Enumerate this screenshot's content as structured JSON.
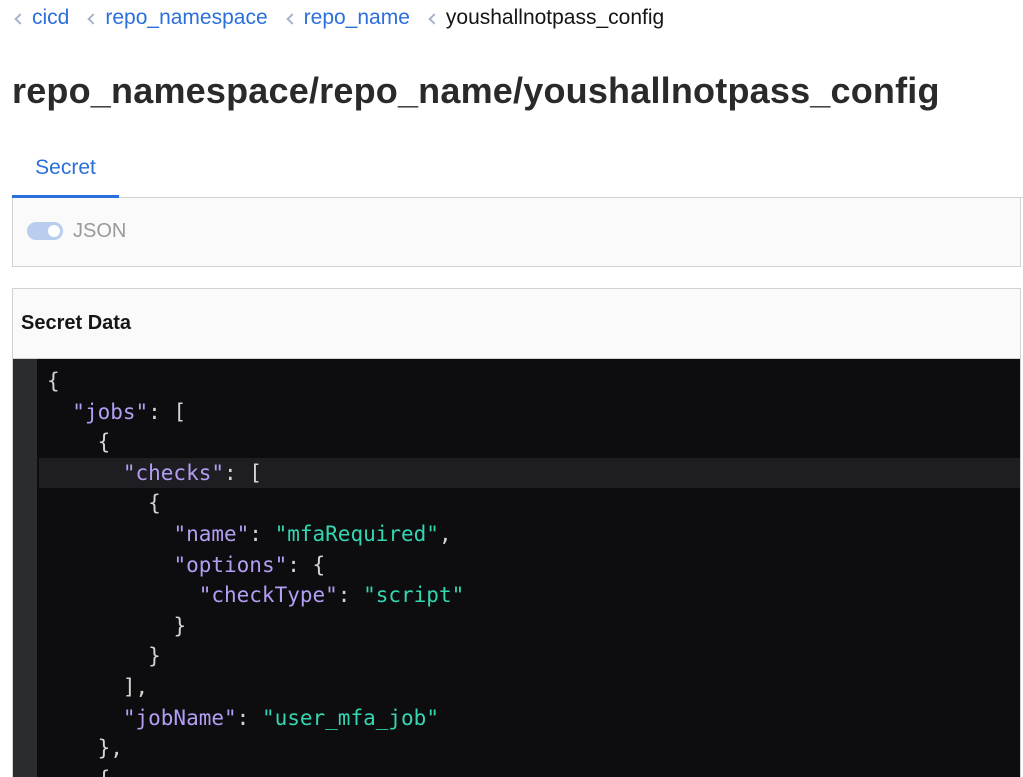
{
  "breadcrumb": [
    {
      "label": "cicd",
      "link": true
    },
    {
      "label": "repo_namespace",
      "link": true
    },
    {
      "label": "repo_name",
      "link": true
    },
    {
      "label": "youshallnotpass_config",
      "link": false
    }
  ],
  "page_title": "repo_namespace/repo_name/youshallnotpass_config",
  "tabs": [
    {
      "label": "Secret",
      "active": true
    }
  ],
  "toggle": {
    "label": "JSON",
    "on": true
  },
  "secret_data": {
    "title": "Secret Data",
    "code_lines": [
      {
        "indent": "",
        "parts": [
          {
            "t": "{"
          }
        ]
      },
      {
        "indent": "  ",
        "parts": [
          {
            "t": "\"jobs\"",
            "c": "k"
          },
          {
            "t": ": ["
          }
        ]
      },
      {
        "indent": "    ",
        "parts": [
          {
            "t": "{"
          }
        ]
      },
      {
        "indent": "      ",
        "parts": [
          {
            "t": "\"checks\"",
            "c": "k"
          },
          {
            "t": ": ["
          }
        ],
        "active": true
      },
      {
        "indent": "        ",
        "parts": [
          {
            "t": "{"
          }
        ]
      },
      {
        "indent": "          ",
        "parts": [
          {
            "t": "\"name\"",
            "c": "k"
          },
          {
            "t": ": "
          },
          {
            "t": "\"mfaRequired\"",
            "c": "s"
          },
          {
            "t": ","
          }
        ]
      },
      {
        "indent": "          ",
        "parts": [
          {
            "t": "\"options\"",
            "c": "k"
          },
          {
            "t": ": {"
          }
        ]
      },
      {
        "indent": "            ",
        "parts": [
          {
            "t": "\"checkType\"",
            "c": "k"
          },
          {
            "t": ": "
          },
          {
            "t": "\"script\"",
            "c": "s"
          }
        ]
      },
      {
        "indent": "          ",
        "parts": [
          {
            "t": "}"
          }
        ]
      },
      {
        "indent": "        ",
        "parts": [
          {
            "t": "}"
          }
        ]
      },
      {
        "indent": "      ",
        "parts": [
          {
            "t": "],"
          }
        ]
      },
      {
        "indent": "      ",
        "parts": [
          {
            "t": "\"jobName\"",
            "c": "k"
          },
          {
            "t": ": "
          },
          {
            "t": "\"user_mfa_job\"",
            "c": "s"
          }
        ]
      },
      {
        "indent": "    ",
        "parts": [
          {
            "t": "},"
          }
        ]
      },
      {
        "indent": "    ",
        "parts": [
          {
            "t": "{"
          }
        ]
      }
    ]
  },
  "colors": {
    "link": "#2b6fdb",
    "json_key": "#b49df2",
    "json_string": "#33d6b1",
    "editor_bg": "#0d0d0f"
  }
}
